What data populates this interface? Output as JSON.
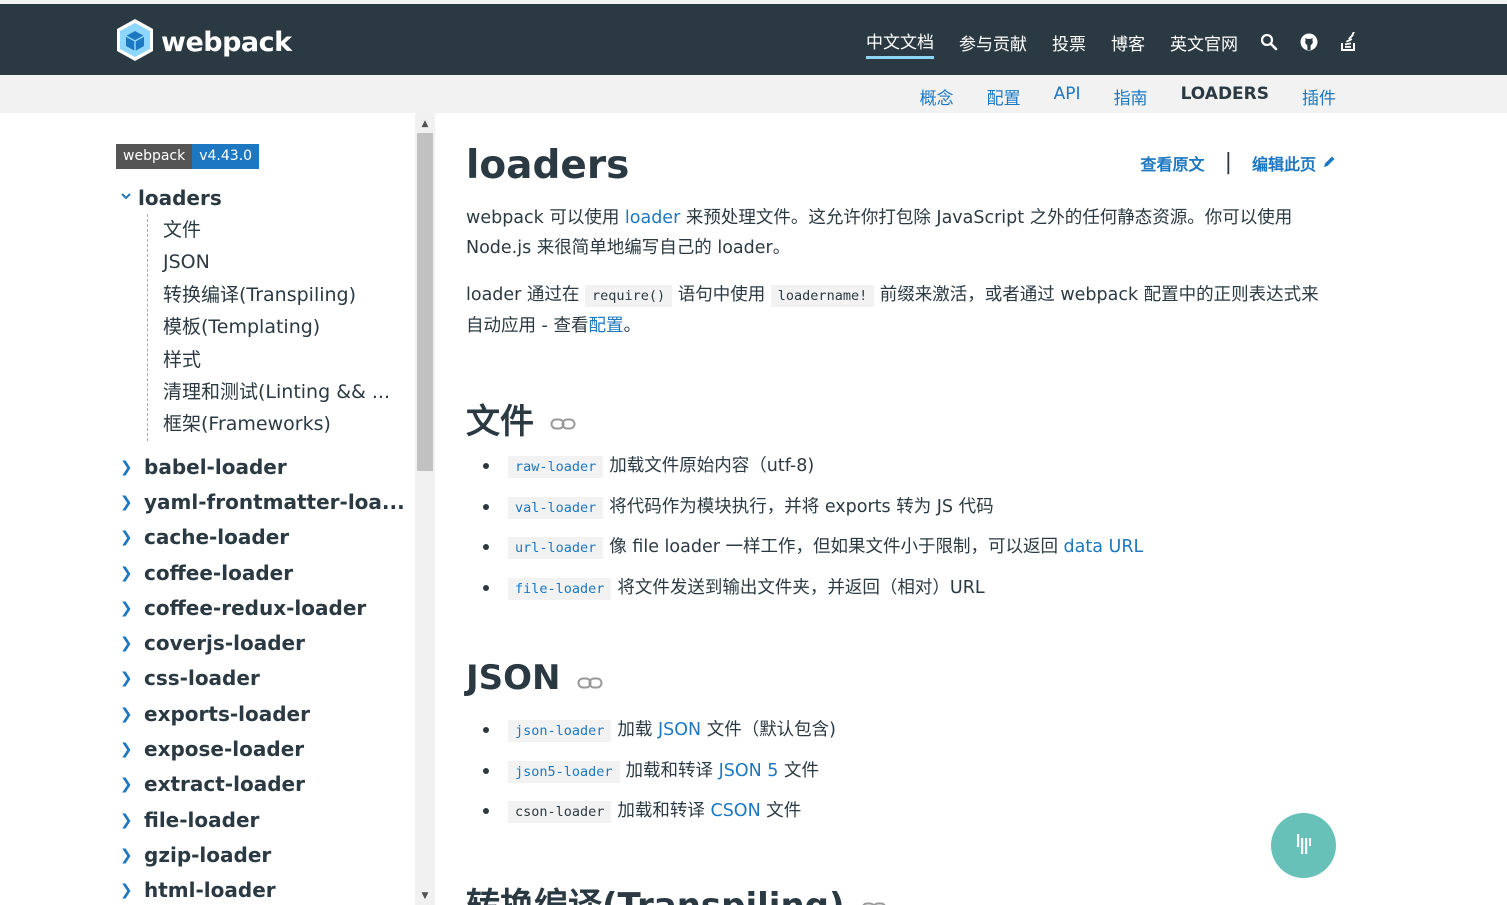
{
  "brand": {
    "name": "webpack"
  },
  "main_nav": [
    {
      "label": "中文文档",
      "active": true
    },
    {
      "label": "参与贡献"
    },
    {
      "label": "投票"
    },
    {
      "label": "博客"
    },
    {
      "label": "英文官网"
    }
  ],
  "sub_nav": [
    {
      "label": "概念"
    },
    {
      "label": "配置"
    },
    {
      "label": "API"
    },
    {
      "label": "指南"
    },
    {
      "label": "LOADERS",
      "active": true
    },
    {
      "label": "插件"
    }
  ],
  "sidebar": {
    "badge_key": "webpack",
    "badge_value": "v4.43.0",
    "group": {
      "title": "loaders",
      "children": [
        "文件",
        "JSON",
        "转换编译(Transpiling)",
        "模板(Templating)",
        "样式",
        "清理和测试(Linting && ...",
        "框架(Frameworks)"
      ]
    },
    "items": [
      "babel-loader",
      "yaml-frontmatter-loa...",
      "cache-loader",
      "coffee-loader",
      "coffee-redux-loader",
      "coverjs-loader",
      "css-loader",
      "exports-loader",
      "expose-loader",
      "extract-loader",
      "file-loader",
      "gzip-loader",
      "html-loader"
    ]
  },
  "page": {
    "title": "loaders",
    "view_source": "查看原文",
    "edit_page": "编辑此页",
    "intro1": {
      "a": "webpack 可以使用 ",
      "link": "loader",
      "b": " 来预处理文件。这允许你打包除 JavaScript 之外的任何静态资源。你可以使用 Node.js 来很简单地编写自己的 loader。"
    },
    "intro2": {
      "a": "loader 通过在 ",
      "code1": "require()",
      "b": " 语句中使用 ",
      "code2": "loadername!",
      "c": " 前缀来激活，或者通过 webpack 配置中的正则表达式来自动应用 - 查看",
      "link": "配置",
      "d": "。"
    },
    "sections": [
      {
        "heading": "文件",
        "items": [
          {
            "code": "raw-loader",
            "text": "加载文件原始内容（utf-8)"
          },
          {
            "code": "val-loader",
            "text": "将代码作为模块执行，并将 exports 转为 JS 代码"
          },
          {
            "code": "url-loader",
            "text": "像 file loader 一样工作，但如果文件小于限制，可以返回 ",
            "link": "data URL"
          },
          {
            "code": "file-loader",
            "text": "将文件发送到输出文件夹，并返回（相对）URL"
          }
        ]
      },
      {
        "heading": "JSON",
        "items": [
          {
            "code": "json-loader",
            "text": "加载 ",
            "link": "JSON",
            "text2": " 文件（默认包含)"
          },
          {
            "code": "json5-loader",
            "text": "加载和转译 ",
            "link": "JSON 5",
            "text2": " 文件"
          },
          {
            "code": "cson-loader",
            "text": "加载和转译 ",
            "link": "CSON",
            "text2": " 文件"
          }
        ]
      },
      {
        "heading": "转换编译(Transpiling)"
      }
    ]
  },
  "colors": {
    "header_bg": "#2b3a42",
    "link": "#1d78c1",
    "gitter": "#68c1b9"
  },
  "icons": [
    "webpack-cube-icon",
    "search-icon",
    "github-icon",
    "stackoverflow-icon",
    "link-icon",
    "edit-pencil-icon",
    "gitter-icon"
  ]
}
